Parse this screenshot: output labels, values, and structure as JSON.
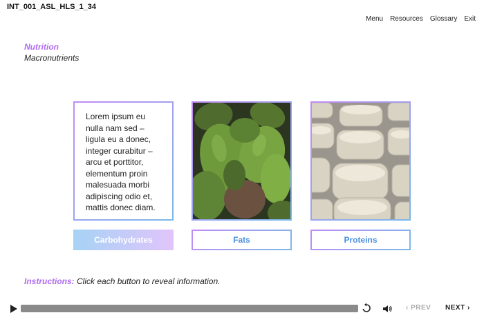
{
  "course_id": "INT_001_ASL_HLS_1_34",
  "top_nav": [
    "Menu",
    "Resources",
    "Glossary",
    "Exit"
  ],
  "heading": {
    "topic": "Nutrition",
    "subtopic": "Macronutrients"
  },
  "info_card": {
    "text": "Lorem ipsum eu nulla nam sed – ligula eu a donec, integer curabitur – arcu et porttitor, elementum proin malesuada morbi adipiscing odio et, mattis donec diam."
  },
  "buttons": [
    {
      "label": "Carbohydrates",
      "state": "active"
    },
    {
      "label": "Fats",
      "state": "inactive"
    },
    {
      "label": "Proteins",
      "state": "inactive"
    }
  ],
  "images": [
    {
      "icon": "avocados-image"
    },
    {
      "icon": "cheese-rounds-image"
    }
  ],
  "instructions": {
    "label": "Instructions:",
    "text": "Click each button to reveal information."
  },
  "player": {
    "prev": "PREV",
    "next": "NEXT"
  },
  "colors": {
    "accent": "#b06cf2",
    "blue": "#4a90e2"
  }
}
